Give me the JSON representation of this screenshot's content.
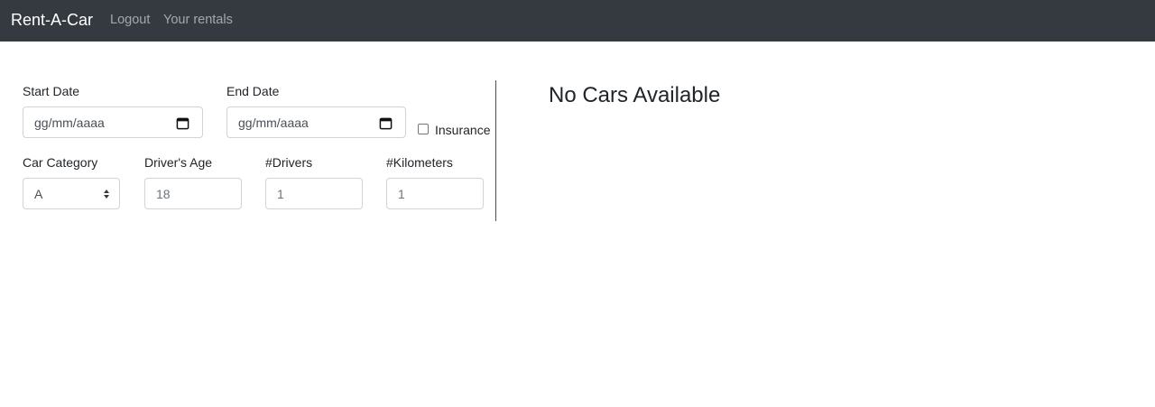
{
  "navbar": {
    "brand": "Rent-A-Car",
    "links": [
      "Logout",
      "Your rentals"
    ],
    "background": "#343a40"
  },
  "form": {
    "start_date": {
      "label": "Start Date",
      "placeholder": "gg/mm/aaaa"
    },
    "end_date": {
      "label": "End Date",
      "placeholder": "gg/mm/aaaa"
    },
    "insurance": {
      "label": "Insurance",
      "checked": false
    },
    "car_category": {
      "label": "Car Category",
      "value": "A"
    },
    "drivers_age": {
      "label": "Driver's Age",
      "placeholder": "18"
    },
    "drivers": {
      "label": "#Drivers",
      "placeholder": "1"
    },
    "kilometers": {
      "label": "#Kilometers",
      "placeholder": "1"
    }
  },
  "results": {
    "heading": "No Cars Available"
  }
}
